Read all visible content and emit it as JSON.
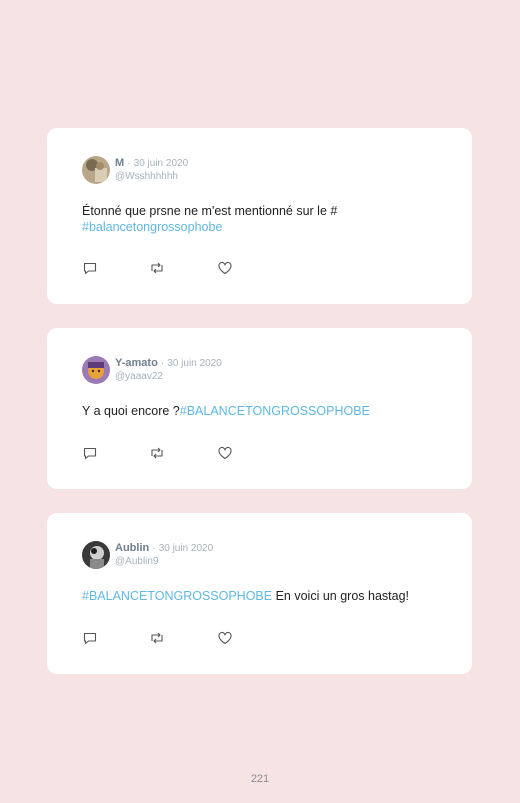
{
  "tweets": [
    {
      "name": "M",
      "date": "30 juin 2020",
      "handle": "@Wsshhhhhh",
      "text_before": "Étonné que prsne ne m'est mentionné sur le #",
      "hashtag": "#balancetongrossophobe",
      "text_after": "",
      "avatar": "avatar-photo-1"
    },
    {
      "name": "Y-amato",
      "date": "30 juin 2020",
      "handle": "@yaaav22",
      "text_before": "Y a quoi encore ?",
      "hashtag": "#BALANCETONGROSSOPHOBE",
      "text_after": "",
      "avatar": "avatar-photo-2"
    },
    {
      "name": "Aublin",
      "date": "30 juin 2020",
      "handle": "@Aublin9",
      "text_before": "",
      "hashtag": "#BALANCETONGROSSOPHOBE",
      "text_after": " En voici un gros hastag!",
      "avatar": "avatar-photo-3"
    }
  ],
  "separator": "·",
  "page_number": "221",
  "icons": [
    "reply-icon",
    "retweet-icon",
    "like-icon"
  ],
  "colors": {
    "background": "#f6e3e4",
    "card": "#ffffff",
    "hashtag": "#5fb8e1",
    "name": "#6e7f8f",
    "meta": "#a7b1ba"
  }
}
